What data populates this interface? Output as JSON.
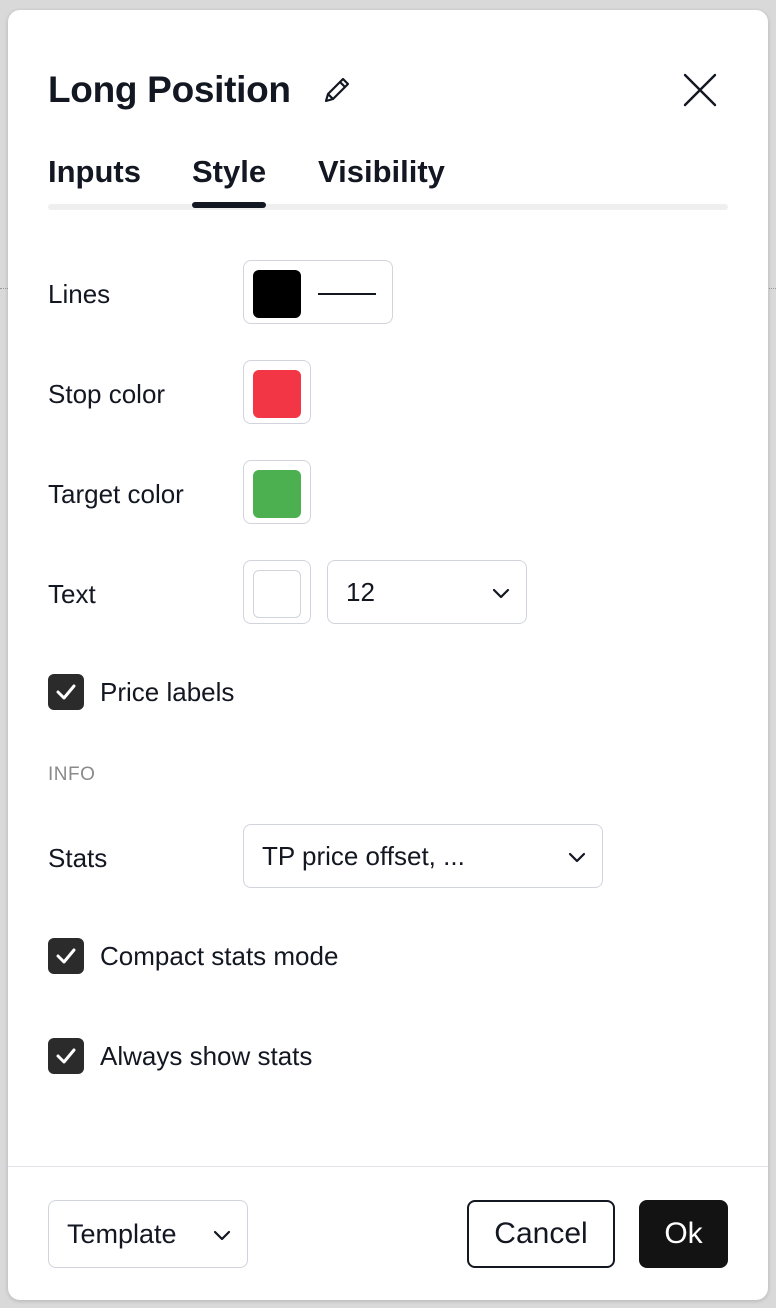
{
  "dialog": {
    "title": "Long Position",
    "edit_icon": "pencil-icon",
    "close_icon": "close-icon"
  },
  "tabs": [
    {
      "label": "Inputs",
      "active": false
    },
    {
      "label": "Style",
      "active": true
    },
    {
      "label": "Visibility",
      "active": false
    }
  ],
  "style": {
    "lines": {
      "label": "Lines",
      "color": "#000000"
    },
    "stop_color": {
      "label": "Stop color",
      "color": "#f23645"
    },
    "target_color": {
      "label": "Target color",
      "color": "#4caf50"
    },
    "text": {
      "label": "Text",
      "color": "#ffffff",
      "font_size": "12"
    },
    "price_labels": {
      "label": "Price labels",
      "checked": true
    }
  },
  "info": {
    "section_label": "INFO",
    "stats": {
      "label": "Stats",
      "value": "TP price offset, ..."
    },
    "compact_stats_mode": {
      "label": "Compact stats mode",
      "checked": true
    },
    "always_show_stats": {
      "label": "Always show stats",
      "checked": true
    }
  },
  "footer": {
    "template_label": "Template",
    "cancel_label": "Cancel",
    "ok_label": "Ok"
  }
}
